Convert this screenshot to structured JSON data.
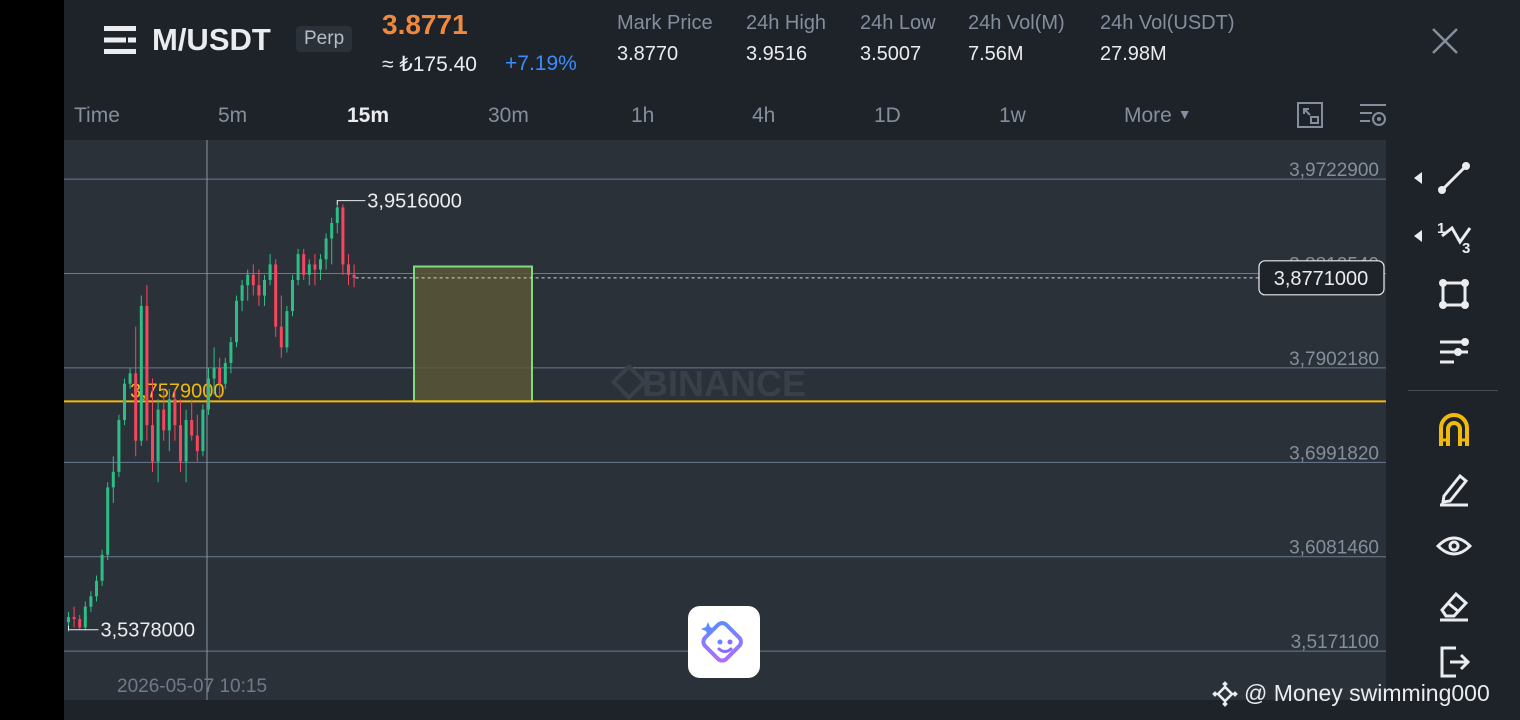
{
  "header": {
    "pair": "M/USDT",
    "contract_type": "Perp",
    "last_price": "3.8771",
    "approx_prefix": "≈ ₺175.40",
    "change": "+7.19%",
    "stats": [
      {
        "label": "Mark Price",
        "value": "3.8770"
      },
      {
        "label": "24h High",
        "value": "3.9516"
      },
      {
        "label": "24h Low",
        "value": "3.5007"
      },
      {
        "label": "24h Vol(M)",
        "value": "7.56M"
      },
      {
        "label": "24h Vol(USDT)",
        "value": "27.98M"
      }
    ]
  },
  "timeframes": {
    "items": [
      "Time",
      "5m",
      "15m",
      "30m",
      "1h",
      "4h",
      "1D",
      "1w"
    ],
    "active": "15m",
    "more_label": "More"
  },
  "chart": {
    "axis_labels": [
      "3,9722900",
      "3,8812540",
      "3,7902180",
      "3,6991820",
      "3,6081460",
      "3,5171100"
    ],
    "current_price_tag": "3,8771000",
    "high_marker": "3,9516000",
    "low_marker": "3,5378000",
    "horizontal_line_label": "3,7579000",
    "watermark": "BINANCE",
    "crosshair_time": "2026-05-07 10:15"
  },
  "chart_data": {
    "type": "candlestick",
    "ylim": [
      3.47,
      4.01
    ],
    "y_ticks": [
      3.97229,
      3.881254,
      3.790218,
      3.699182,
      3.608146,
      3.51711
    ],
    "last_price": 3.8771,
    "high": 3.9516,
    "low": 3.5378,
    "horizontal_line": 3.7579,
    "box_zone": {
      "top": 3.888,
      "bottom": 3.758
    },
    "candles": [
      [
        3.545,
        3.555,
        3.536,
        3.55
      ],
      [
        3.55,
        3.56,
        3.54,
        3.548
      ],
      [
        3.548,
        3.552,
        3.538,
        3.54
      ],
      [
        3.54,
        3.565,
        3.537,
        3.56
      ],
      [
        3.56,
        3.575,
        3.555,
        3.57
      ],
      [
        3.57,
        3.59,
        3.565,
        3.585
      ],
      [
        3.585,
        3.615,
        3.58,
        3.61
      ],
      [
        3.61,
        3.68,
        3.605,
        3.675
      ],
      [
        3.675,
        3.705,
        3.66,
        3.69
      ],
      [
        3.69,
        3.745,
        3.685,
        3.74
      ],
      [
        3.74,
        3.78,
        3.735,
        3.775
      ],
      [
        3.775,
        3.79,
        3.77,
        3.785
      ],
      [
        3.785,
        3.83,
        3.705,
        3.72
      ],
      [
        3.72,
        3.86,
        3.715,
        3.85
      ],
      [
        3.85,
        3.87,
        3.72,
        3.735
      ],
      [
        3.735,
        3.78,
        3.69,
        3.7
      ],
      [
        3.7,
        3.76,
        3.68,
        3.75
      ],
      [
        3.75,
        3.77,
        3.72,
        3.73
      ],
      [
        3.73,
        3.77,
        3.71,
        3.76
      ],
      [
        3.76,
        3.77,
        3.72,
        3.735
      ],
      [
        3.735,
        3.76,
        3.69,
        3.7
      ],
      [
        3.7,
        3.75,
        3.68,
        3.74
      ],
      [
        3.74,
        3.76,
        3.72,
        3.725
      ],
      [
        3.725,
        3.745,
        3.7,
        3.71
      ],
      [
        3.71,
        3.755,
        3.705,
        3.75
      ],
      [
        3.75,
        3.79,
        3.745,
        3.78
      ],
      [
        3.78,
        3.81,
        3.765,
        3.79
      ],
      [
        3.79,
        3.8,
        3.76,
        3.775
      ],
      [
        3.775,
        3.8,
        3.77,
        3.795
      ],
      [
        3.795,
        3.82,
        3.785,
        3.815
      ],
      [
        3.815,
        3.86,
        3.81,
        3.855
      ],
      [
        3.855,
        3.875,
        3.845,
        3.87
      ],
      [
        3.87,
        3.885,
        3.855,
        3.88
      ],
      [
        3.88,
        3.89,
        3.86,
        3.87
      ],
      [
        3.87,
        3.885,
        3.85,
        3.86
      ],
      [
        3.86,
        3.88,
        3.85,
        3.875
      ],
      [
        3.875,
        3.9,
        3.87,
        3.89
      ],
      [
        3.89,
        3.895,
        3.82,
        3.83
      ],
      [
        3.83,
        3.86,
        3.8,
        3.81
      ],
      [
        3.81,
        3.85,
        3.805,
        3.845
      ],
      [
        3.845,
        3.88,
        3.84,
        3.875
      ],
      [
        3.875,
        3.905,
        3.87,
        3.9
      ],
      [
        3.9,
        3.905,
        3.875,
        3.88
      ],
      [
        3.88,
        3.895,
        3.87,
        3.89
      ],
      [
        3.89,
        3.9,
        3.87,
        3.885
      ],
      [
        3.885,
        3.9,
        3.875,
        3.895
      ],
      [
        3.895,
        3.92,
        3.885,
        3.915
      ],
      [
        3.915,
        3.935,
        3.89,
        3.93
      ],
      [
        3.93,
        3.952,
        3.92,
        3.945
      ],
      [
        3.945,
        3.948,
        3.88,
        3.89
      ],
      [
        3.89,
        3.9,
        3.87,
        3.88
      ],
      [
        3.88,
        3.89,
        3.868,
        3.877
      ]
    ]
  },
  "colors": {
    "up": "#2ebd85",
    "down": "#f6465d",
    "accent_orange": "#f0883e",
    "accent_blue": "#3b8cff",
    "yellow": "#f0b90b",
    "box_fill": "#5a5638",
    "box_stroke": "#7ddc7d"
  },
  "toolbar": {
    "icons": [
      "trend-line-icon",
      "fib-tool-icon",
      "shape-tool-icon",
      "indicator-list-icon",
      "magnet-icon",
      "pencil-icon",
      "eye-icon",
      "eraser-icon",
      "exit-icon"
    ]
  },
  "footer": {
    "user": "@ Money swimming000"
  }
}
